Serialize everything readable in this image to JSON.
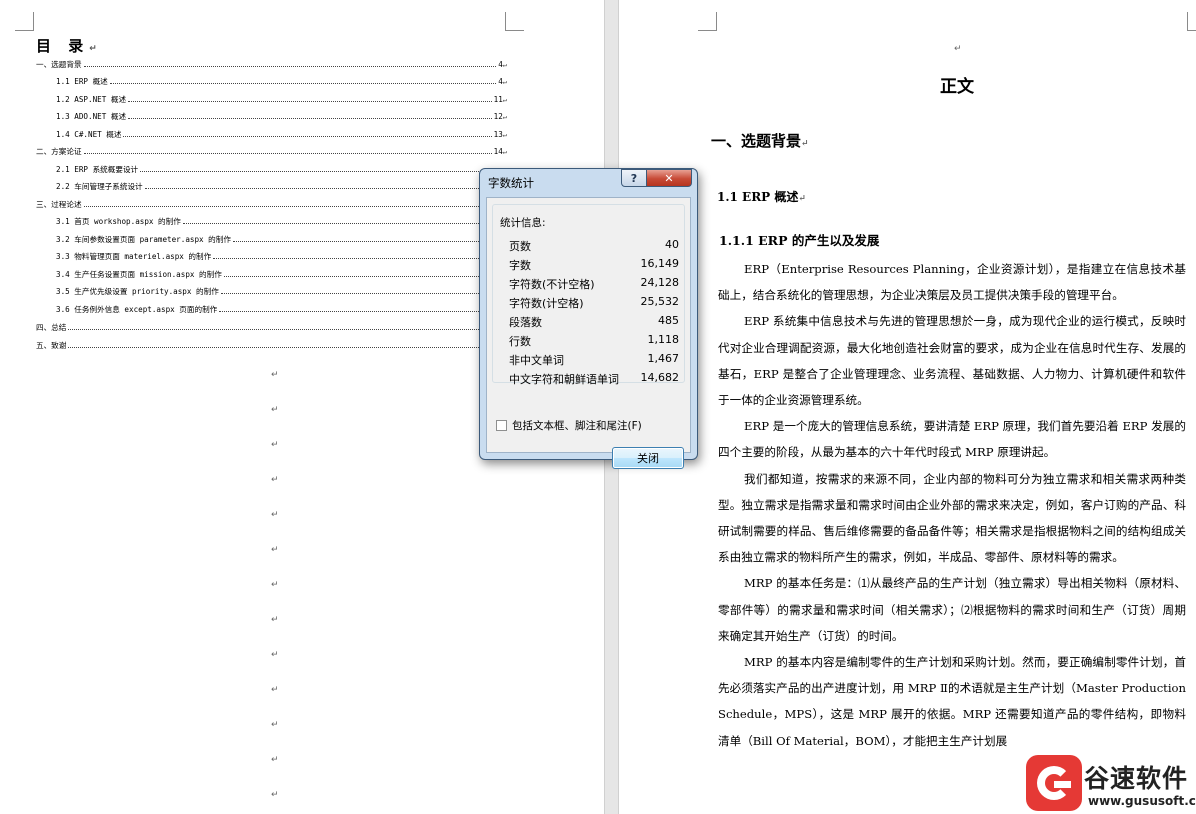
{
  "toc": {
    "title": "目 录",
    "entries": [
      {
        "text": "一、选题背景",
        "page": "4"
      },
      {
        "text": "1.1 ERP 概述",
        "page": "4"
      },
      {
        "text": "1.2 ASP.NET 概述",
        "page": "11"
      },
      {
        "text": "1.3 ADO.NET 概述",
        "page": "12"
      },
      {
        "text": "1.4 C#.NET 概述",
        "page": "13"
      },
      {
        "text": "二、方案论证",
        "page": "14"
      },
      {
        "text": "2.1 ERP 系统概要设计",
        "page": ""
      },
      {
        "text": "2.2 车间管理子系统设计",
        "page": ""
      },
      {
        "text": "三、过程论述",
        "page": ""
      },
      {
        "text": "3.1 首页 workshop.aspx 的制作",
        "page": ""
      },
      {
        "text": "3.2 车间参数设置页面 parameter.aspx 的制作",
        "page": ""
      },
      {
        "text": "3.3 物料管理页面 materiel.aspx 的制作",
        "page": ""
      },
      {
        "text": "3.4 生产任务设置页面 mission.aspx 的制作",
        "page": ""
      },
      {
        "text": "3.5 生产优先级设置 priority.aspx 的制作",
        "page": ""
      },
      {
        "text": "3.6 任务例外信息 except.aspx 页面的制作",
        "page": ""
      },
      {
        "text": "四、总结",
        "page": ""
      },
      {
        "text": "五、致谢",
        "page": ""
      }
    ]
  },
  "marks": {
    "paragraph": "↵"
  },
  "document": {
    "title": "正文",
    "h1": "一、选题背景",
    "h2": "1.1 ERP 概述",
    "h3": "1.1.1 ERP 的产生以及发展",
    "paragraphs": [
      "ERP（Enterprise Resources Planning，企业资源计划），是指建立在信息技术基础上，结合系统化的管理思想，为企业决策层及员工提供决策手段的管理平台。",
      "ERP 系统集中信息技术与先进的管理思想於一身，成为现代企业的运行模式，反映时代对企业合理调配资源，最大化地创造社会财富的要求，成为企业在信息时代生存、发展的基石，ERP 是整合了企业管理理念、业务流程、基础数据、人力物力、计算机硬件和软件于一体的企业资源管理系统。",
      "ERP 是一个庞大的管理信息系统，要讲清楚 ERP 原理，我们首先要沿着 ERP 发展的四个主要的阶段，从最为基本的六十年代时段式 MRP 原理讲起。",
      "我们都知道，按需求的来源不同，企业内部的物料可分为独立需求和相关需求两种类型。独立需求是指需求量和需求时间由企业外部的需求来决定，例如，客户订购的产品、科研试制需要的样品、售后维修需要的备品备件等；相关需求是指根据物料之间的结构组成关系由独立需求的物料所产生的需求，例如，半成品、零部件、原材料等的需求。",
      "MRP 的基本任务是：⑴从最终产品的生产计划（独立需求）导出相关物料（原材料、零部件等）的需求量和需求时间（相关需求）；⑵根据物料的需求时间和生产（订货）周期来确定其开始生产（订货）的时间。",
      "MRP 的基本内容是编制零件的生产计划和采购计划。然而，要正确编制零件计划，首先必须落实产品的出产进度计划，用 MRP Ⅱ的术语就是主生产计划（Master Production Schedule，MPS），这是 MRP 展开的依据。MRP 还需要知道产品的零件结构，即物料清单（Bill Of Material，BOM），才能把主生产计划展"
    ]
  },
  "dialog": {
    "title": "字数统计",
    "help_label": "?",
    "close_glyph": "✕",
    "group_label": "统计信息:",
    "stats": [
      {
        "label": "页数",
        "value": "40"
      },
      {
        "label": "字数",
        "value": "16,149"
      },
      {
        "label": "字符数(不计空格)",
        "value": "24,128"
      },
      {
        "label": "字符数(计空格)",
        "value": "25,532"
      },
      {
        "label": "段落数",
        "value": "485"
      },
      {
        "label": "行数",
        "value": "1,118"
      },
      {
        "label": "非中文单词",
        "value": "1,467"
      },
      {
        "label": "中文字符和朝鲜语单词",
        "value": "14,682"
      }
    ],
    "checkbox_label": "包括文本框、脚注和尾注(F)",
    "checkbox_checked": false,
    "button_label": "关闭"
  },
  "watermark": {
    "name": "谷速软件",
    "url": "www.gususoft.com"
  }
}
